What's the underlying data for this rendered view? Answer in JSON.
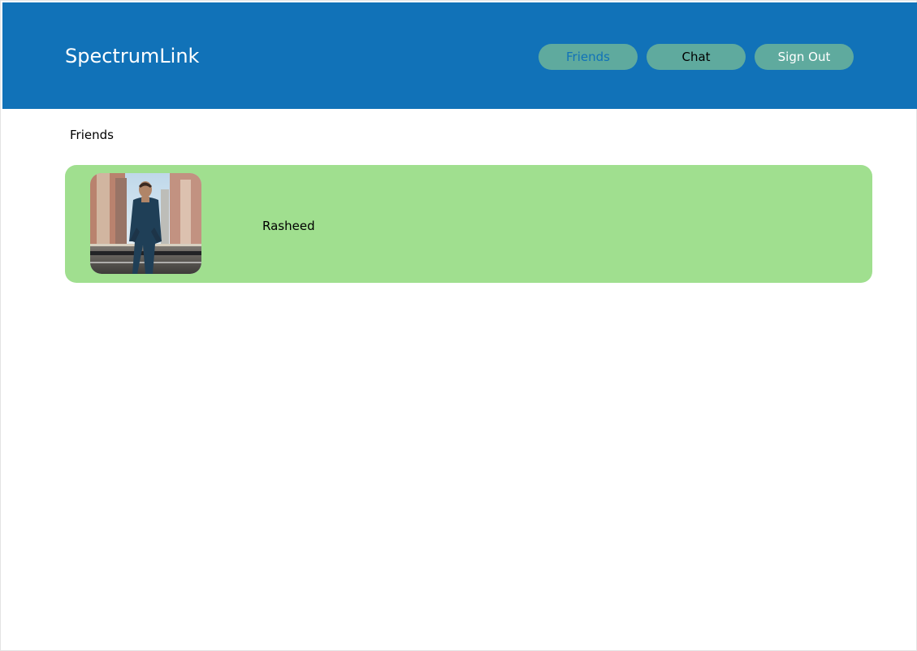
{
  "app": {
    "title": "SpectrumLink"
  },
  "nav": {
    "items": [
      {
        "label": "Friends",
        "bg": "#5faa9e",
        "text_color": "#1172b8"
      },
      {
        "label": "Chat",
        "bg": "#5faa9e",
        "text_color": "#000000"
      },
      {
        "label": "Sign Out",
        "bg": "#5faa9e",
        "text_color": "#ffffff"
      }
    ]
  },
  "main": {
    "section_title": "Friends",
    "friends": [
      {
        "name": "Rasheed",
        "avatar_icon": "avatar-photo",
        "card_color": "#a0df8f"
      }
    ]
  },
  "colors": {
    "header_bg": "#1172b8",
    "page_bg": "#ffffff"
  }
}
